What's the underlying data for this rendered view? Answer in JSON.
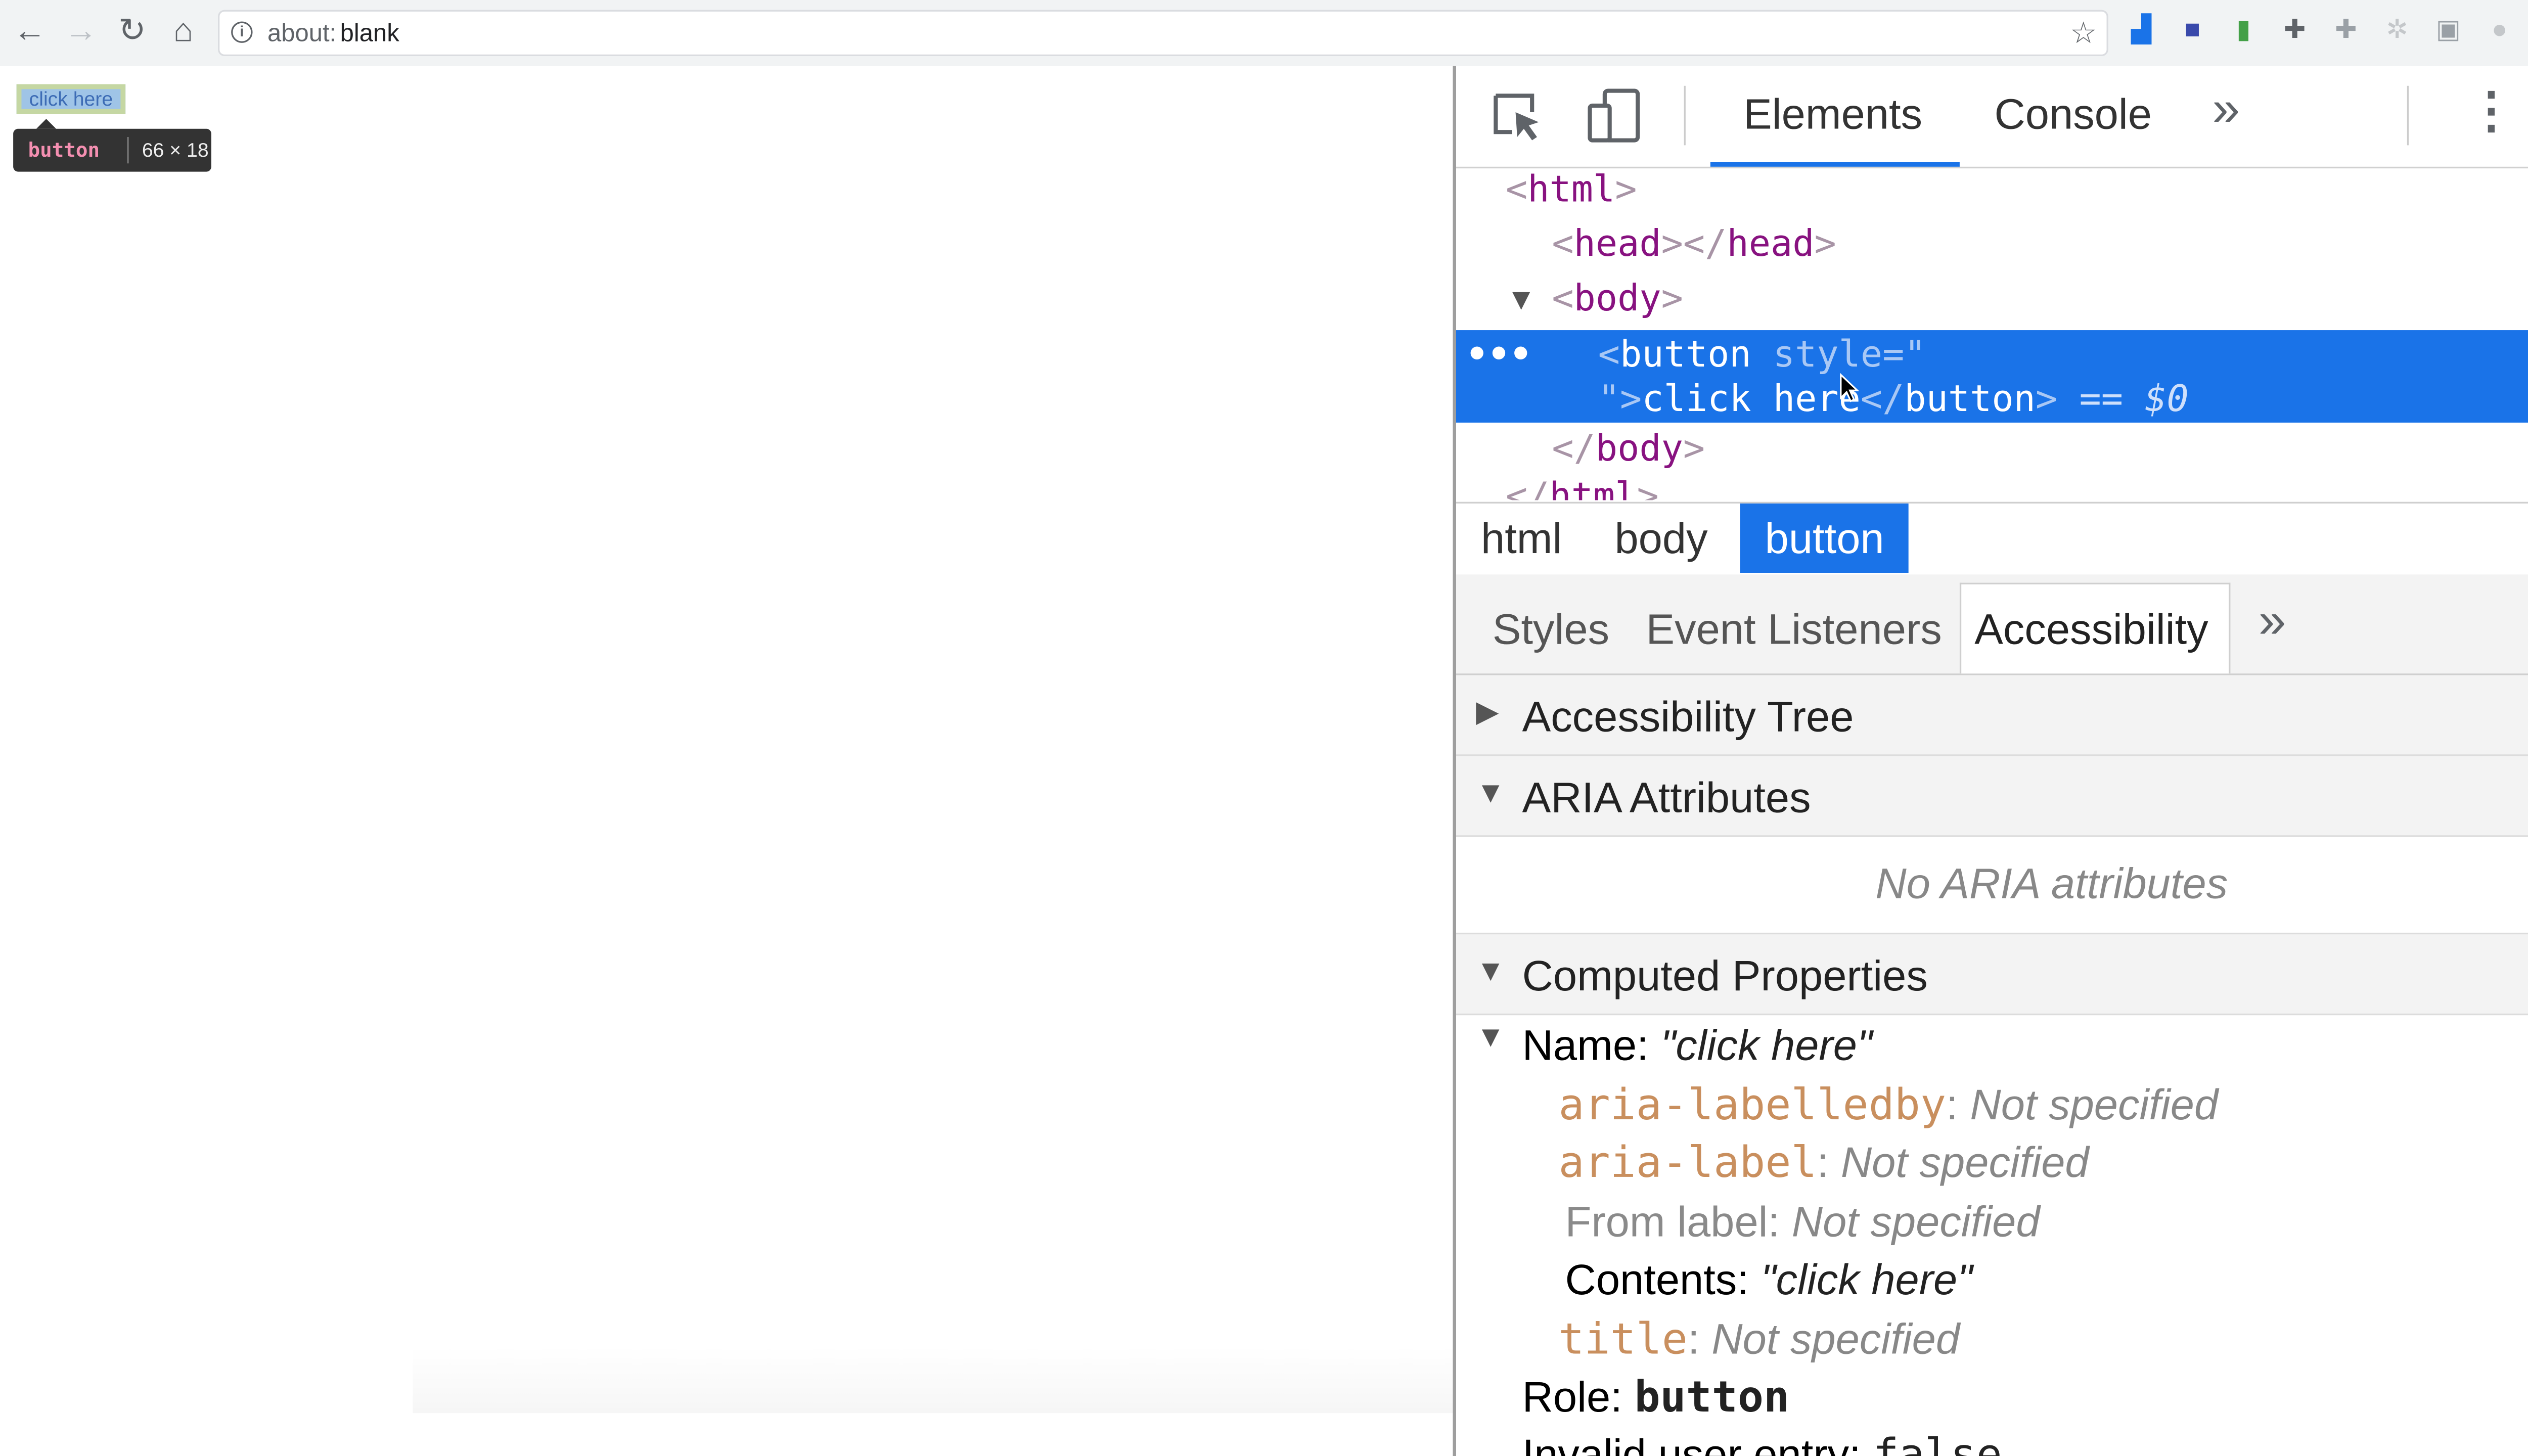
{
  "browser": {
    "url_prefix": "about:",
    "url_host": "blank"
  },
  "page": {
    "button_label": "click here",
    "tooltip": {
      "tag": "button",
      "dims": "66 × 18"
    }
  },
  "devtools": {
    "tabs": [
      "Elements",
      "Console"
    ],
    "dom": {
      "html_open": "html",
      "head": "head",
      "body_open": "body",
      "button_tag": "button",
      "button_attr": "style",
      "button_text": "click here",
      "button_ref": "== $0",
      "body_close": "body",
      "html_close": "html"
    },
    "breadcrumbs": [
      "html",
      "body",
      "button"
    ],
    "subtabs": [
      "Styles",
      "Event Listeners",
      "Accessibility"
    ],
    "sections": {
      "tree": "Accessibility Tree",
      "aria": "ARIA Attributes",
      "no_aria": "No ARIA attributes",
      "computed": "Computed Properties"
    },
    "computed": {
      "name_label": "Name:",
      "name_value": "\"click here\"",
      "labelledby_key": "aria-labelledby",
      "labelledby_val": "Not specified",
      "label_key": "aria-label",
      "label_val": "Not specified",
      "from_label_key": "From label:",
      "from_label_val": "Not specified",
      "contents_key": "Contents:",
      "contents_val": "\"click here\"",
      "title_key": "title",
      "title_val": "Not specified",
      "role_key": "Role:",
      "role_val": "button",
      "invalid_key": "Invalid user entry:",
      "invalid_val": "false"
    }
  }
}
